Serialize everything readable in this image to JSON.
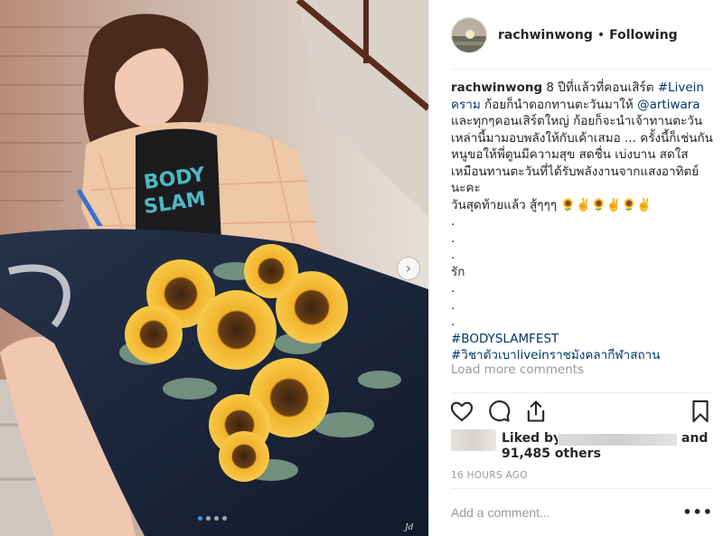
{
  "post": {
    "username": "rachwinwong",
    "header_separator": "•",
    "follow_status": "Following",
    "caption": {
      "username": "rachwinwong",
      "text_1": " 8 ปีที่แล้วที่คอนเสิร์ต ",
      "hashtag_1": "#Livein คราม",
      "text_2": " ก้อยก็นำดอกทานตะวันมาให้ ",
      "mention_1": "@artiwara",
      "text_3": " และทุกๆคอนเสิร์ตใหญ่ ก้อยก็จะนำเจ้าทานตะวันเหล่านี้มามอบพลังให้กับเค้าเสมอ ... ครั้งนี้ก็เช่นกันหนูขอให้พี่ตูนมีความสุข สดชื่น เบ่งบาน สดใส เหมือนทานตะวันที่ได้รับพลังงานจากแสงอาทิตย์นะคะ",
      "line_last": "วันสุดท้ายแล้ว สู้ๆๆๆ 🌻✌️🌻✌️🌻✌️",
      "dot": ".",
      "love": "รัก",
      "hashtag_2": "#BODYSLAMFEST",
      "hashtag_3": "#วิชาตัวเบาliveinราชมังคลากีฬาสถาน"
    },
    "load_more_label": "Load more comments",
    "liked_by_label": "Liked by",
    "and_label": "and",
    "others_label": "91,485 others",
    "timestamp": "16 HOURS AGO",
    "comment_placeholder": "Add a comment...",
    "more_label": "•••"
  },
  "carousel": {
    "count": 4,
    "active_index": 0
  },
  "icons": {
    "like": "heart-icon",
    "comment": "comment-icon",
    "share": "share-icon",
    "save": "bookmark-icon",
    "next": "chevron-right-icon"
  },
  "colors": {
    "text": "#262626",
    "muted": "#999999",
    "link": "#003569",
    "active_dot": "#3897f0",
    "border": "#efefef"
  }
}
